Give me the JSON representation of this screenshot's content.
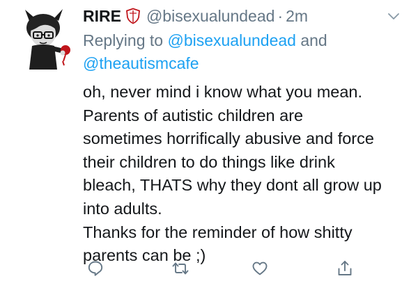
{
  "tweet": {
    "display_name": "RIRE",
    "badge_icon": "shield-icon",
    "handle": "@bisexualundead",
    "separator": "·",
    "time": "2m",
    "reply_prefix": "Replying to",
    "reply_mentions": [
      "@bisexualundead",
      "@theautismcafe"
    ],
    "reply_joiner": "and",
    "body_lines": [
      "oh, never mind i know what you mean.",
      "Parents of autistic children are",
      "sometimes horrifically abusive and force",
      "their children to do things like drink",
      "bleach, THATS why they dont all grow up",
      "into adults.",
      "Thanks for the reminder of how shitty",
      "parents can be ;)"
    ]
  },
  "actions": [
    {
      "name": "reply",
      "icon": "comment-icon"
    },
    {
      "name": "retweet",
      "icon": "retweet-icon"
    },
    {
      "name": "like",
      "icon": "heart-icon"
    },
    {
      "name": "share",
      "icon": "share-icon"
    }
  ],
  "colors": {
    "accent": "#1da1f2",
    "secondary_text": "#657786",
    "primary_text": "#14171a",
    "icon": "#657786"
  }
}
